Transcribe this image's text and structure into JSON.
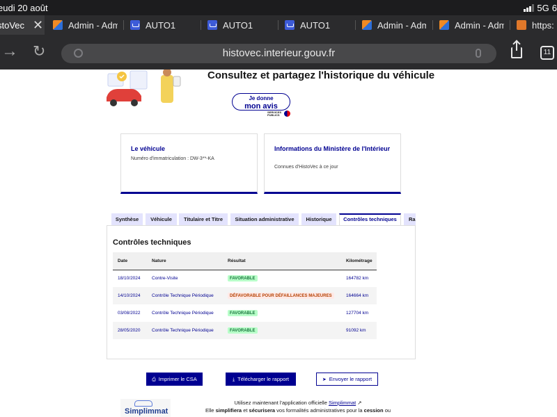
{
  "status_bar": {
    "time": "eudi 20 août",
    "network": "5G",
    "battery": "6"
  },
  "browser": {
    "tabs": [
      {
        "label": "stoVec",
        "favicon": "auto1-icon",
        "active": true
      },
      {
        "label": "Admin - Adm",
        "favicon": "admin-icon"
      },
      {
        "label": "AUTO1",
        "favicon": "auto1-icon"
      },
      {
        "label": "AUTO1",
        "favicon": "auto1-icon"
      },
      {
        "label": "AUTO1",
        "favicon": "auto1-icon"
      },
      {
        "label": "Admin - Adm",
        "favicon": "admin-icon"
      },
      {
        "label": "Admin - Adm",
        "favicon": "admin-icon"
      },
      {
        "label": "https:",
        "favicon": "site-icon"
      }
    ],
    "close_glyph": "✕",
    "url": "histovec.interieur.gouv.fr",
    "tab_count": "11"
  },
  "page": {
    "hero_title": "Consultez et partagez l'historique du véhicule",
    "avis_button": {
      "line1": "Je donne",
      "line2": "mon avis"
    },
    "services_publics": {
      "line1": "SERVICES",
      "line2": "PUBLICS"
    },
    "cards": [
      {
        "title": "Le véhicule",
        "text": "Numéro d'immatriculation : DW-3**-KA"
      },
      {
        "title": "Informations du Ministère de l'Intérieur",
        "text": "Connues d'HistoVec à ce jour"
      }
    ],
    "tabs": [
      {
        "label": "Synthèse"
      },
      {
        "label": "Véhicule"
      },
      {
        "label": "Titulaire et Titre"
      },
      {
        "label": "Situation administrative"
      },
      {
        "label": "Historique"
      },
      {
        "label": "Contrôles techniques",
        "active": true
      },
      {
        "label": "Ra"
      }
    ],
    "section_title": "Contrôles techniques",
    "table": {
      "headers": [
        "Date",
        "Nature",
        "Résultat",
        "Kilométrage"
      ],
      "rows": [
        {
          "date": "18/10/2024",
          "nature": "Contre-Visite",
          "result": "FAVORABLE",
          "status": "ok",
          "km": "164782 km"
        },
        {
          "date": "14/10/2024",
          "nature": "Contrôle Technique Périodique",
          "result": "DÉFAVORABLE POUR DÉFAILLANCES MAJEURES",
          "status": "ko",
          "km": "164664 km"
        },
        {
          "date": "03/08/2022",
          "nature": "Contrôle Technique Périodique",
          "result": "FAVORABLE",
          "status": "ok",
          "km": "127704 km"
        },
        {
          "date": "28/05/2020",
          "nature": "Contrôle Technique Périodique",
          "result": "FAVORABLE",
          "status": "ok",
          "km": "91092 km"
        }
      ]
    },
    "actions": {
      "print": "Imprimer le CSA",
      "download": "Télécharger le rapport",
      "send": "Envoyer le rapport"
    },
    "footer": {
      "logo_text": "Simplimmat",
      "line1_prefix": "Utilisez maintenant l'application officielle",
      "line1_link": "Simplimmat",
      "line2_a": "Elle",
      "line2_b": "simplifiera",
      "line2_c": "et",
      "line2_d": "sécurisera",
      "line2_e": "vos formalités administratives pour la",
      "line2_f": "cession",
      "line2_g": "ou"
    }
  }
}
